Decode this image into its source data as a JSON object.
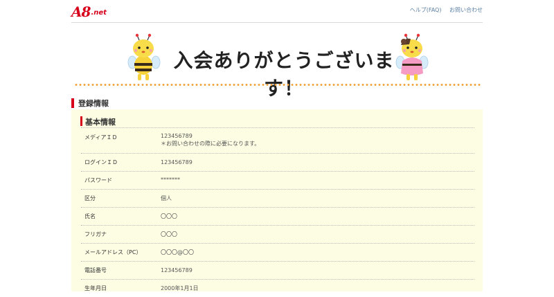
{
  "header": {
    "logo_main": "A8",
    "logo_net": ".net",
    "links": [
      "ヘルプ(FAQ)",
      "お問い合わせ"
    ]
  },
  "banner": {
    "title": "入会ありがとうございます！"
  },
  "section": {
    "title": "登録情報"
  },
  "basic": {
    "title": "基本情報",
    "rows": [
      {
        "label": "メディアＩＤ",
        "value": "123456789",
        "note": "＊お問い合わせの際に必要になります。"
      },
      {
        "label": "ログインＩＤ",
        "value": "123456789"
      },
      {
        "label": "パスワード",
        "value": "*******"
      },
      {
        "label": "区分",
        "value": "個人"
      },
      {
        "label": "氏名",
        "value": "〇〇〇"
      },
      {
        "label": "フリガナ",
        "value": "〇〇〇"
      },
      {
        "label": "メールアドレス（PC）",
        "value": "〇〇〇@〇〇"
      },
      {
        "label": "電話番号",
        "value": "123456789"
      },
      {
        "label": "生年月日",
        "value": "2000年1月1日"
      }
    ]
  },
  "colors": {
    "accent_red": "#d7001b",
    "panel_bg": "#fdfde4",
    "dot_orange": "#f0a33a"
  }
}
